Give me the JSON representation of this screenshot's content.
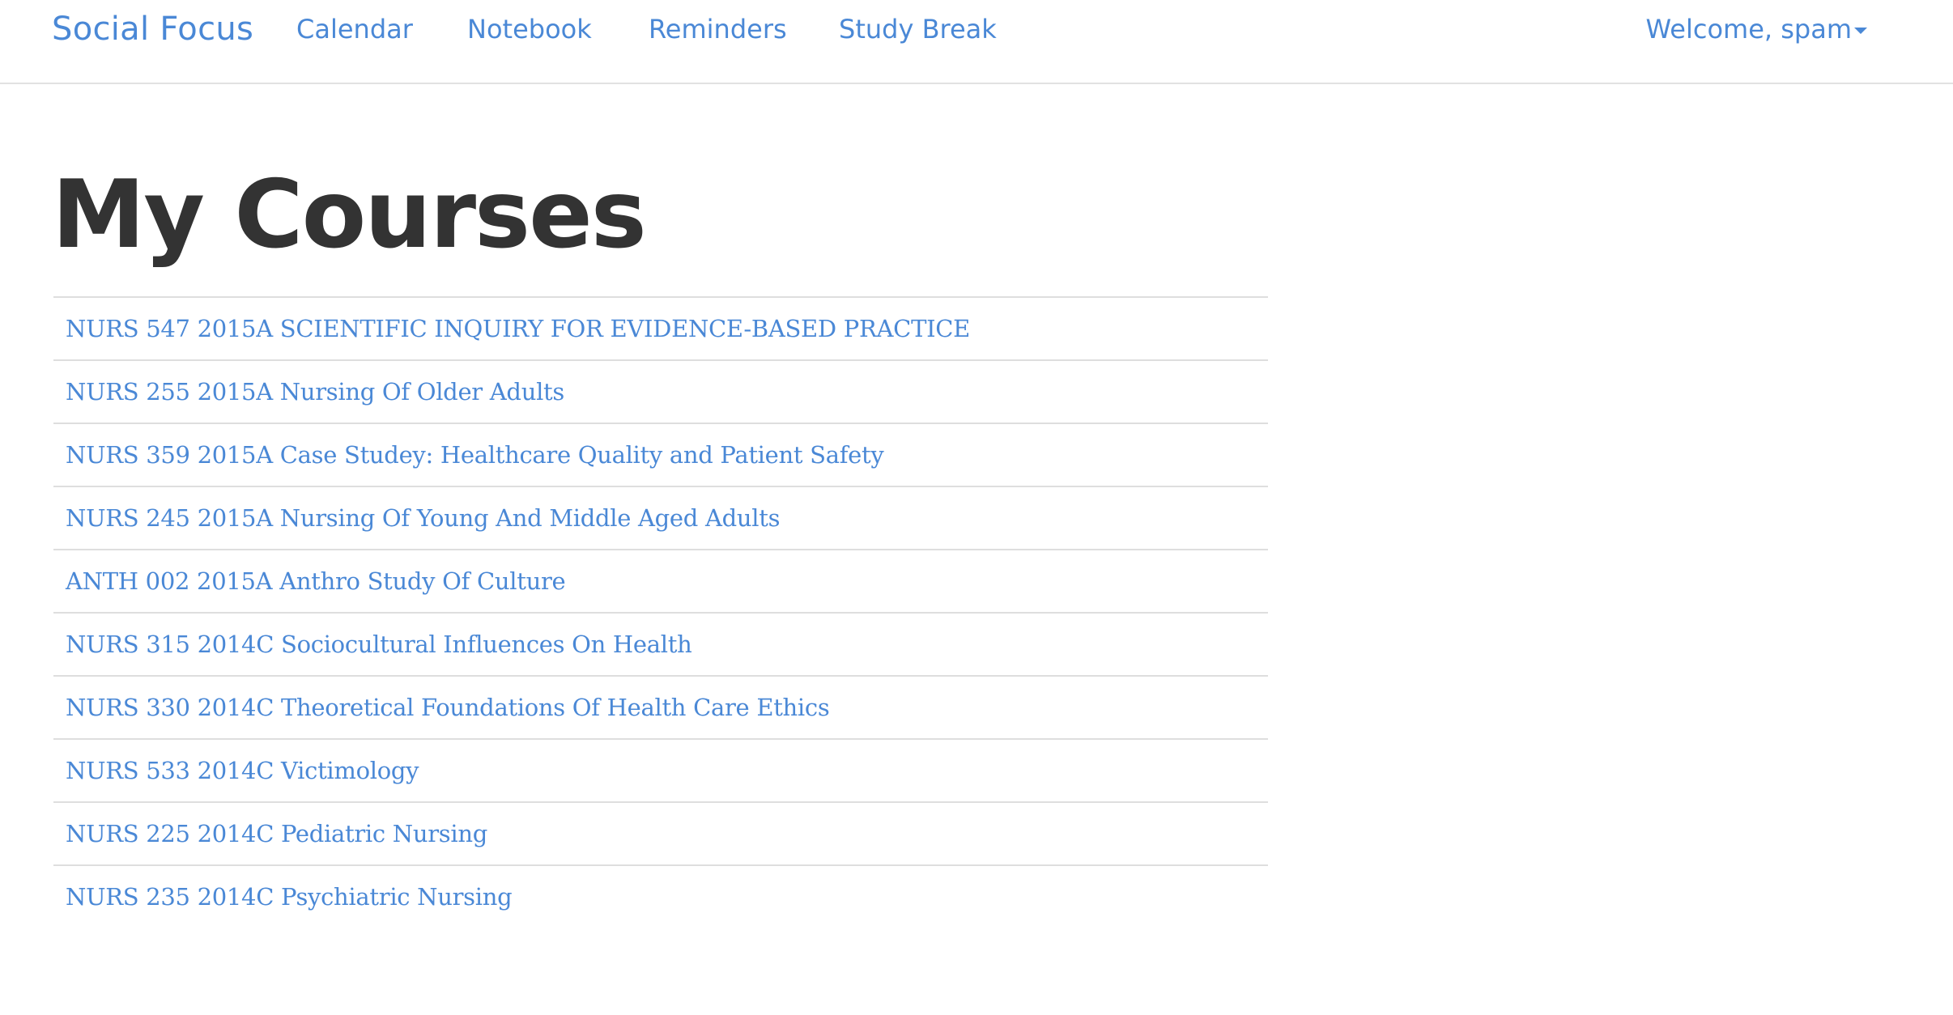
{
  "navbar": {
    "brand": "Social Focus",
    "links": [
      {
        "label": "Calendar"
      },
      {
        "label": "Notebook"
      },
      {
        "label": "Reminders"
      },
      {
        "label": "Study Break"
      }
    ],
    "user_menu": "Welcome, spam"
  },
  "page_title": "My Courses",
  "courses": [
    "NURS 547 2015A SCIENTIFIC INQUIRY FOR EVIDENCE-BASED PRACTICE",
    "NURS 255 2015A Nursing Of Older Adults",
    "NURS 359 2015A Case Studey: Healthcare Quality and Patient Safety",
    "NURS 245 2015A Nursing Of Young And Middle Aged Adults",
    "ANTH 002 2015A Anthro Study Of Culture",
    "NURS 315 2014C Sociocultural Influences On Health",
    "NURS 330 2014C Theoretical Foundations Of Health Care Ethics",
    "NURS 533 2014C Victimology",
    "NURS 225 2014C Pediatric Nursing",
    "NURS 235 2014C Psychiatric Nursing"
  ],
  "colors": {
    "link": "#4a88d6",
    "title": "#333333",
    "divider": "#dedede"
  },
  "icons": {
    "user_menu_caret": "caret-down-icon"
  }
}
